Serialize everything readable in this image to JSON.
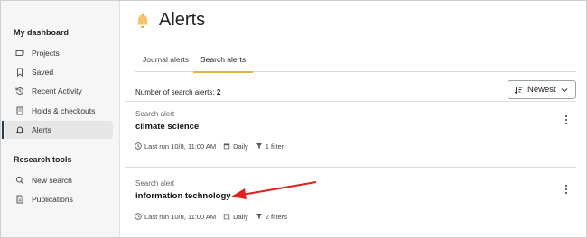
{
  "sidebar": {
    "dashboard_heading": "My dashboard",
    "items": [
      {
        "label": "Projects",
        "icon": "projects-icon"
      },
      {
        "label": "Saved",
        "icon": "bookmark-icon"
      },
      {
        "label": "Recent Activity",
        "icon": "history-icon"
      },
      {
        "label": "Holds & checkouts",
        "icon": "book-icon"
      },
      {
        "label": "Alerts",
        "icon": "bell-icon",
        "active": true
      }
    ],
    "tools_heading": "Research tools",
    "tools": [
      {
        "label": "New search",
        "icon": "search-icon"
      },
      {
        "label": "Publications",
        "icon": "document-icon"
      }
    ]
  },
  "page": {
    "title": "Alerts",
    "title_icon": "bell-icon",
    "tabs": [
      {
        "label": "Journal alerts",
        "active": false
      },
      {
        "label": "Search alerts",
        "active": true
      }
    ],
    "count_label": "Number of search alerts:",
    "count_value": "2",
    "sort": {
      "selected": "Newest"
    }
  },
  "alerts": [
    {
      "kind": "Search alert",
      "name": "climate science",
      "last_run": "Last run 10/8, 11:00 AM",
      "frequency": "Daily",
      "filters": "1 filter"
    },
    {
      "kind": "Search alert",
      "name": "information technology",
      "last_run": "Last run 10/8, 11:00 AM",
      "frequency": "Daily",
      "filters": "2 filters"
    }
  ],
  "colors": {
    "accent": "#e0b44b",
    "sidebar_bg": "#f6f6f6",
    "annotation_arrow": "#e02020"
  }
}
